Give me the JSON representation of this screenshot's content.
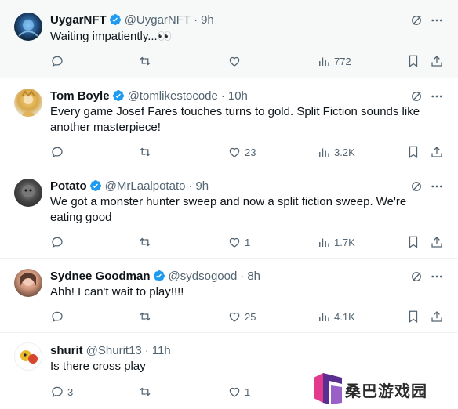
{
  "tweets": [
    {
      "name": "UygarNFT",
      "handle": "@UygarNFT",
      "time": "9h",
      "text": "Waiting impatiently...👀",
      "replies": "",
      "retweets": "",
      "likes": "",
      "views": "772",
      "verified": true
    },
    {
      "name": "Tom Boyle",
      "handle": "@tomlikestocode",
      "time": "10h",
      "text": "Every game Josef Fares touches turns to gold. Split Fiction sounds like another masterpiece!",
      "replies": "",
      "retweets": "",
      "likes": "23",
      "views": "3.2K",
      "verified": true
    },
    {
      "name": "Potato",
      "handle": "@MrLaalpotato",
      "time": "9h",
      "text": "We got a monster hunter sweep and now a split fiction sweep. We're eating good",
      "replies": "",
      "retweets": "",
      "likes": "1",
      "views": "1.7K",
      "verified": true
    },
    {
      "name": "Sydnee Goodman",
      "handle": "@sydsogood",
      "time": "8h",
      "text": "Ahh! I can't wait to play!!!!",
      "replies": "",
      "retweets": "",
      "likes": "25",
      "views": "4.1K",
      "verified": true
    },
    {
      "name": "shurit",
      "handle": "@Shurit13",
      "time": "11h",
      "text": "Is there cross play",
      "replies": "3",
      "retweets": "",
      "likes": "1",
      "views": "",
      "verified": false
    }
  ],
  "watermark": {
    "text": "桑巴游戏园"
  },
  "colors": {
    "accent": "#1d9bf0",
    "muted": "#536471",
    "watermark_pink": "#e23a8c",
    "watermark_purple": "#5b2f91"
  }
}
